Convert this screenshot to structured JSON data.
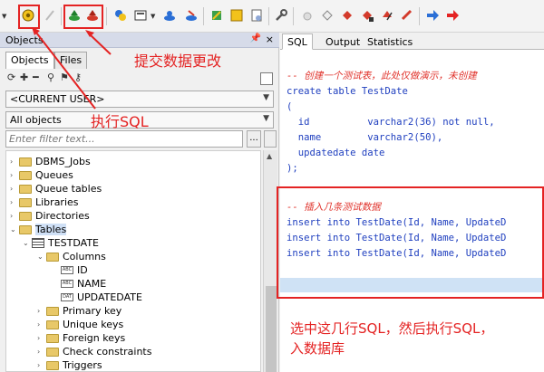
{
  "left_panel": {
    "title": "Objects",
    "pin": "ᵽ",
    "close": "×",
    "tabs": [
      {
        "label": "Objects"
      },
      {
        "label": "Files"
      }
    ],
    "user_combo": "<CURRENT USER>",
    "objects_combo": "All objects",
    "filter_placeholder": "Enter filter text...",
    "dots": "...",
    "tree": {
      "items": [
        {
          "label": "DBMS_Jobs"
        },
        {
          "label": "Queues"
        },
        {
          "label": "Queue tables"
        },
        {
          "label": "Libraries"
        },
        {
          "label": "Directories"
        },
        {
          "label": "Tables"
        },
        {
          "label": "TESTDATE"
        },
        {
          "label": "Columns"
        },
        {
          "label": "ID"
        },
        {
          "label": "NAME"
        },
        {
          "label": "UPDATEDATE"
        },
        {
          "label": "Primary key"
        },
        {
          "label": "Unique keys"
        },
        {
          "label": "Foreign keys"
        },
        {
          "label": "Check constraints"
        },
        {
          "label": "Triggers"
        }
      ]
    }
  },
  "right_panel": {
    "tabs": [
      {
        "label": "SQL"
      },
      {
        "label": "Output"
      },
      {
        "label": "Statistics"
      }
    ],
    "code": {
      "c1": "-- 创建一个测试表，此处仅做演示，未创建",
      "l1": "create table TestDate",
      "l2": "(",
      "l3": "  id          varchar2(36) not null,",
      "l4": "  name        varchar2(50),",
      "l5": "  updatedate date",
      "l6": ");",
      "c2": "-- 插入几条测试数据",
      "i1": "insert into TestDate(Id, Name, UpdateD",
      "i2": "insert into TestDate(Id, Name, UpdateD",
      "i3": "insert into TestDate(Id, Name, UpdateD"
    }
  },
  "annotations": {
    "commit": "提交数据更改",
    "execute": "执行SQL",
    "bottom_line1": "选中这几行SQL，然后执行SQL，",
    "bottom_line2": "入数据库"
  },
  "colors": {
    "annotation": "#e42323",
    "comment": "#e0322b",
    "keyword": "#1f3fbf",
    "selection": "#cfe2f5"
  },
  "icons": [
    "execute-gear-icon",
    "break-icon",
    "commit-icon",
    "rollback-icon",
    "new-icon",
    "window-icon",
    "tools-icon",
    "arrow-right-icon",
    "arrow-left-icon"
  ]
}
